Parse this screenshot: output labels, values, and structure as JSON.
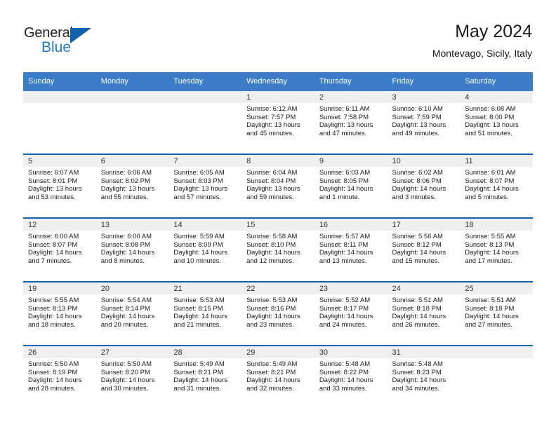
{
  "brand": {
    "name_part1": "General",
    "name_part2": "Blue",
    "triangle_color": "#1461ab",
    "blue_color": "#1f7ac4"
  },
  "header": {
    "title": "May 2024",
    "subtitle": "Montevago, Sicily, Italy"
  },
  "theme": {
    "header_row_bg": "#3a7cc7",
    "cell_border": "#1461ab",
    "daynum_band_bg": "#efefef"
  },
  "weekday_headers": [
    "Sunday",
    "Monday",
    "Tuesday",
    "Wednesday",
    "Thursday",
    "Friday",
    "Saturday"
  ],
  "weeks": [
    [
      {
        "day": "",
        "sunrise": "",
        "sunset": "",
        "daylight_line1": "",
        "daylight_line2": "",
        "empty": true
      },
      {
        "day": "",
        "sunrise": "",
        "sunset": "",
        "daylight_line1": "",
        "daylight_line2": "",
        "empty": true
      },
      {
        "day": "",
        "sunrise": "",
        "sunset": "",
        "daylight_line1": "",
        "daylight_line2": "",
        "empty": true
      },
      {
        "day": "1",
        "sunrise": "Sunrise: 6:12 AM",
        "sunset": "Sunset: 7:57 PM",
        "daylight_line1": "Daylight: 13 hours",
        "daylight_line2": "and 45 minutes.",
        "empty": false
      },
      {
        "day": "2",
        "sunrise": "Sunrise: 6:11 AM",
        "sunset": "Sunset: 7:58 PM",
        "daylight_line1": "Daylight: 13 hours",
        "daylight_line2": "and 47 minutes.",
        "empty": false
      },
      {
        "day": "3",
        "sunrise": "Sunrise: 6:10 AM",
        "sunset": "Sunset: 7:59 PM",
        "daylight_line1": "Daylight: 13 hours",
        "daylight_line2": "and 49 minutes.",
        "empty": false
      },
      {
        "day": "4",
        "sunrise": "Sunrise: 6:08 AM",
        "sunset": "Sunset: 8:00 PM",
        "daylight_line1": "Daylight: 13 hours",
        "daylight_line2": "and 51 minutes.",
        "empty": false
      }
    ],
    [
      {
        "day": "5",
        "sunrise": "Sunrise: 6:07 AM",
        "sunset": "Sunset: 8:01 PM",
        "daylight_line1": "Daylight: 13 hours",
        "daylight_line2": "and 53 minutes.",
        "empty": false
      },
      {
        "day": "6",
        "sunrise": "Sunrise: 6:06 AM",
        "sunset": "Sunset: 8:02 PM",
        "daylight_line1": "Daylight: 13 hours",
        "daylight_line2": "and 55 minutes.",
        "empty": false
      },
      {
        "day": "7",
        "sunrise": "Sunrise: 6:05 AM",
        "sunset": "Sunset: 8:03 PM",
        "daylight_line1": "Daylight: 13 hours",
        "daylight_line2": "and 57 minutes.",
        "empty": false
      },
      {
        "day": "8",
        "sunrise": "Sunrise: 6:04 AM",
        "sunset": "Sunset: 8:04 PM",
        "daylight_line1": "Daylight: 13 hours",
        "daylight_line2": "and 59 minutes.",
        "empty": false
      },
      {
        "day": "9",
        "sunrise": "Sunrise: 6:03 AM",
        "sunset": "Sunset: 8:05 PM",
        "daylight_line1": "Daylight: 14 hours",
        "daylight_line2": "and 1 minute.",
        "empty": false
      },
      {
        "day": "10",
        "sunrise": "Sunrise: 6:02 AM",
        "sunset": "Sunset: 8:06 PM",
        "daylight_line1": "Daylight: 14 hours",
        "daylight_line2": "and 3 minutes.",
        "empty": false
      },
      {
        "day": "11",
        "sunrise": "Sunrise: 6:01 AM",
        "sunset": "Sunset: 8:07 PM",
        "daylight_line1": "Daylight: 14 hours",
        "daylight_line2": "and 5 minutes.",
        "empty": false
      }
    ],
    [
      {
        "day": "12",
        "sunrise": "Sunrise: 6:00 AM",
        "sunset": "Sunset: 8:07 PM",
        "daylight_line1": "Daylight: 14 hours",
        "daylight_line2": "and 7 minutes.",
        "empty": false
      },
      {
        "day": "13",
        "sunrise": "Sunrise: 6:00 AM",
        "sunset": "Sunset: 8:08 PM",
        "daylight_line1": "Daylight: 14 hours",
        "daylight_line2": "and 8 minutes.",
        "empty": false
      },
      {
        "day": "14",
        "sunrise": "Sunrise: 5:59 AM",
        "sunset": "Sunset: 8:09 PM",
        "daylight_line1": "Daylight: 14 hours",
        "daylight_line2": "and 10 minutes.",
        "empty": false
      },
      {
        "day": "15",
        "sunrise": "Sunrise: 5:58 AM",
        "sunset": "Sunset: 8:10 PM",
        "daylight_line1": "Daylight: 14 hours",
        "daylight_line2": "and 12 minutes.",
        "empty": false
      },
      {
        "day": "16",
        "sunrise": "Sunrise: 5:57 AM",
        "sunset": "Sunset: 8:11 PM",
        "daylight_line1": "Daylight: 14 hours",
        "daylight_line2": "and 13 minutes.",
        "empty": false
      },
      {
        "day": "17",
        "sunrise": "Sunrise: 5:56 AM",
        "sunset": "Sunset: 8:12 PM",
        "daylight_line1": "Daylight: 14 hours",
        "daylight_line2": "and 15 minutes.",
        "empty": false
      },
      {
        "day": "18",
        "sunrise": "Sunrise: 5:55 AM",
        "sunset": "Sunset: 8:13 PM",
        "daylight_line1": "Daylight: 14 hours",
        "daylight_line2": "and 17 minutes.",
        "empty": false
      }
    ],
    [
      {
        "day": "19",
        "sunrise": "Sunrise: 5:55 AM",
        "sunset": "Sunset: 8:13 PM",
        "daylight_line1": "Daylight: 14 hours",
        "daylight_line2": "and 18 minutes.",
        "empty": false
      },
      {
        "day": "20",
        "sunrise": "Sunrise: 5:54 AM",
        "sunset": "Sunset: 8:14 PM",
        "daylight_line1": "Daylight: 14 hours",
        "daylight_line2": "and 20 minutes.",
        "empty": false
      },
      {
        "day": "21",
        "sunrise": "Sunrise: 5:53 AM",
        "sunset": "Sunset: 8:15 PM",
        "daylight_line1": "Daylight: 14 hours",
        "daylight_line2": "and 21 minutes.",
        "empty": false
      },
      {
        "day": "22",
        "sunrise": "Sunrise: 5:53 AM",
        "sunset": "Sunset: 8:16 PM",
        "daylight_line1": "Daylight: 14 hours",
        "daylight_line2": "and 23 minutes.",
        "empty": false
      },
      {
        "day": "23",
        "sunrise": "Sunrise: 5:52 AM",
        "sunset": "Sunset: 8:17 PM",
        "daylight_line1": "Daylight: 14 hours",
        "daylight_line2": "and 24 minutes.",
        "empty": false
      },
      {
        "day": "24",
        "sunrise": "Sunrise: 5:51 AM",
        "sunset": "Sunset: 8:18 PM",
        "daylight_line1": "Daylight: 14 hours",
        "daylight_line2": "and 26 minutes.",
        "empty": false
      },
      {
        "day": "25",
        "sunrise": "Sunrise: 5:51 AM",
        "sunset": "Sunset: 8:18 PM",
        "daylight_line1": "Daylight: 14 hours",
        "daylight_line2": "and 27 minutes.",
        "empty": false
      }
    ],
    [
      {
        "day": "26",
        "sunrise": "Sunrise: 5:50 AM",
        "sunset": "Sunset: 8:19 PM",
        "daylight_line1": "Daylight: 14 hours",
        "daylight_line2": "and 28 minutes.",
        "empty": false
      },
      {
        "day": "27",
        "sunrise": "Sunrise: 5:50 AM",
        "sunset": "Sunset: 8:20 PM",
        "daylight_line1": "Daylight: 14 hours",
        "daylight_line2": "and 30 minutes.",
        "empty": false
      },
      {
        "day": "28",
        "sunrise": "Sunrise: 5:49 AM",
        "sunset": "Sunset: 8:21 PM",
        "daylight_line1": "Daylight: 14 hours",
        "daylight_line2": "and 31 minutes.",
        "empty": false
      },
      {
        "day": "29",
        "sunrise": "Sunrise: 5:49 AM",
        "sunset": "Sunset: 8:21 PM",
        "daylight_line1": "Daylight: 14 hours",
        "daylight_line2": "and 32 minutes.",
        "empty": false
      },
      {
        "day": "30",
        "sunrise": "Sunrise: 5:48 AM",
        "sunset": "Sunset: 8:22 PM",
        "daylight_line1": "Daylight: 14 hours",
        "daylight_line2": "and 33 minutes.",
        "empty": false
      },
      {
        "day": "31",
        "sunrise": "Sunrise: 5:48 AM",
        "sunset": "Sunset: 8:23 PM",
        "daylight_line1": "Daylight: 14 hours",
        "daylight_line2": "and 34 minutes.",
        "empty": false
      },
      {
        "day": "",
        "sunrise": "",
        "sunset": "",
        "daylight_line1": "",
        "daylight_line2": "",
        "empty": true
      }
    ]
  ]
}
